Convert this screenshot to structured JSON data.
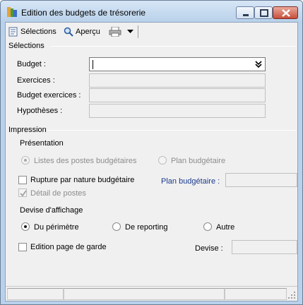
{
  "window": {
    "title": "Edition des budgets de trésorerie"
  },
  "toolbar": {
    "selections_label": "Sélections",
    "preview_label": "Aperçu"
  },
  "selections_group": {
    "title": "Sélections",
    "budget_label": "Budget :",
    "budget_value": "",
    "exercices_label": "Exercices :",
    "exercices_value": "",
    "budget_exercices_label": "Budget exercices :",
    "budget_exercices_value": "",
    "hypotheses_label": "Hypothèses :",
    "hypotheses_value": ""
  },
  "impression_group": {
    "title": "Impression",
    "presentation_label": "Présentation",
    "presentation_options": [
      {
        "label": "Listes des postes budgétaires",
        "selected": true,
        "enabled": false
      },
      {
        "label": "Plan budgétaire",
        "selected": false,
        "enabled": false
      }
    ],
    "rupture_label": "Rupture par nature budgétaire",
    "rupture_checked": false,
    "plan_budgetaire_label": "Plan budgétaire :",
    "plan_budgetaire_value": "",
    "detail_postes_label": "Détail de postes",
    "detail_postes_checked": true,
    "devise_affichage_label": "Devise d'affichage",
    "devise_options": [
      {
        "label": "Du périmètre",
        "selected": true
      },
      {
        "label": "De reporting",
        "selected": false
      },
      {
        "label": "Autre",
        "selected": false
      }
    ],
    "edition_page_garde_label": "Edition page de garde",
    "edition_page_garde_checked": false,
    "devise_label": "Devise :",
    "devise_value": ""
  },
  "colors": {
    "titlebar": "#b9d1ea",
    "client": "#f0f0f0",
    "link_label": "#1a3a8c",
    "close_button": "#c74f3a"
  },
  "icons": [
    "app-icon",
    "selections-icon",
    "preview-icon",
    "print-icon",
    "dropdown-arrow-icon",
    "combo-dropdown-icon",
    "minimize-icon",
    "maximize-icon",
    "close-icon",
    "resize-grip-icon"
  ]
}
